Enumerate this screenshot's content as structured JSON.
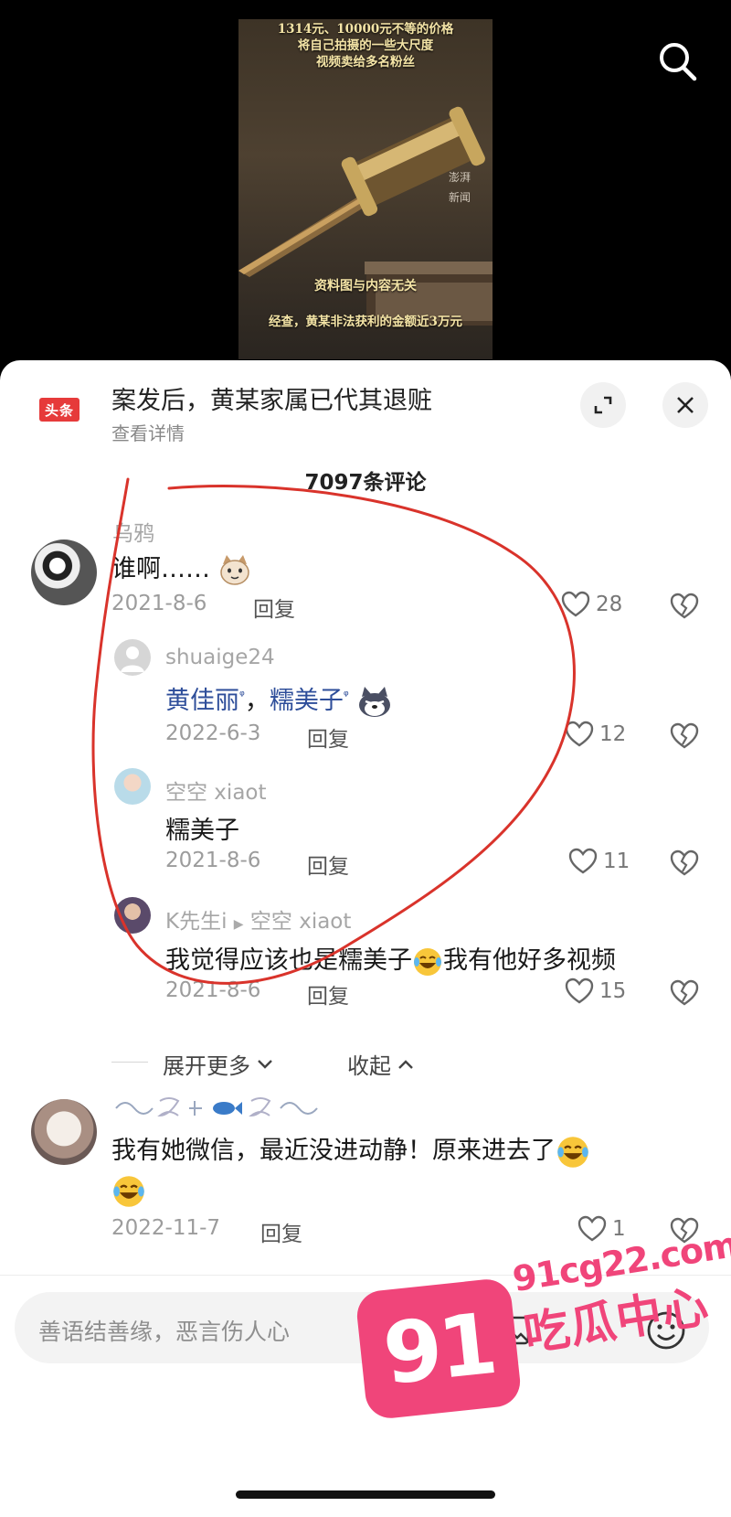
{
  "thumbnail": {
    "caption_top": "1314元、10000元不等的价格\n将自己拍摄的一些大尺度\n视频卖给多名粉丝",
    "watermark": "澎湃\n新闻",
    "caption_mid": "资料图与内容无关",
    "caption_bottom": "经查，黄某非法获利的金额近3万元"
  },
  "header": {
    "app_badge": "头条",
    "headline": "案发后，黄某家属已代其退赃",
    "detail_link": "查看详情",
    "comment_count": "7097条评论"
  },
  "comments": [
    {
      "author": "乌鸦",
      "text": "谁啊……",
      "date": "2021-8-6",
      "reply": "回复",
      "likes": "28"
    },
    {
      "author": "shuaige24",
      "tag1": "黄佳丽",
      "sep": "，",
      "tag2": "糯美子",
      "date": "2022-6-3",
      "reply": "回复",
      "likes": "12"
    },
    {
      "author": "空空 xiaot",
      "text": "糯美子",
      "date": "2021-8-6",
      "reply": "回复",
      "likes": "11"
    },
    {
      "author": "K先生i",
      "reply_to": "空空 xiaot",
      "text1": "我觉得应该也是糯美子",
      "text2": "我有他好多视频",
      "date": "2021-8-6",
      "reply": "回复",
      "likes": "15"
    },
    {
      "text1": "我有她微信，最近没进动静！原来进去了",
      "date": "2022-11-7",
      "reply": "回复",
      "likes": "1"
    }
  ],
  "thread": {
    "expand_more": "展开更多",
    "collapse": "收起"
  },
  "input": {
    "placeholder": "善语结善缘，恶言伤人心"
  },
  "watermark": {
    "number": "91",
    "url": "91cg22.com",
    "text": "吃瓜中心",
    "color": "#f0457a"
  },
  "colors": {
    "annotation_circle": "#d9332b",
    "tag_blue": "#2e4e9a",
    "badge_red": "#e63a3a"
  }
}
